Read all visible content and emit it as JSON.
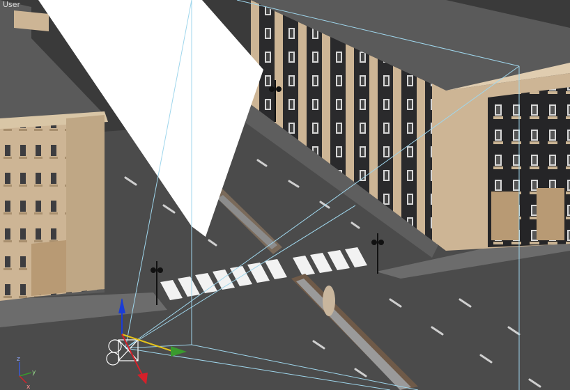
{
  "viewport": {
    "label": "User"
  },
  "axis_gizmo": {
    "x_label": "x",
    "y_label": "y",
    "z_label": "z"
  },
  "colors": {
    "road": "#4b4b4b",
    "sidewalk": "#6c6c6c",
    "roof": "#5a5a5a",
    "facade_tan": "#cdb595",
    "facade_dark": "#252527",
    "plane_white": "#ffffff",
    "frustum_line": "#9fd6ec",
    "gizmo_x": "#e3c21b",
    "gizmo_y": "#3a9a2e",
    "gizmo_z": "#1a3cd6",
    "gizmo_red": "#d4202a"
  },
  "icons": [
    "camera-icon",
    "move-gizmo-icon",
    "world-axis-icon"
  ]
}
